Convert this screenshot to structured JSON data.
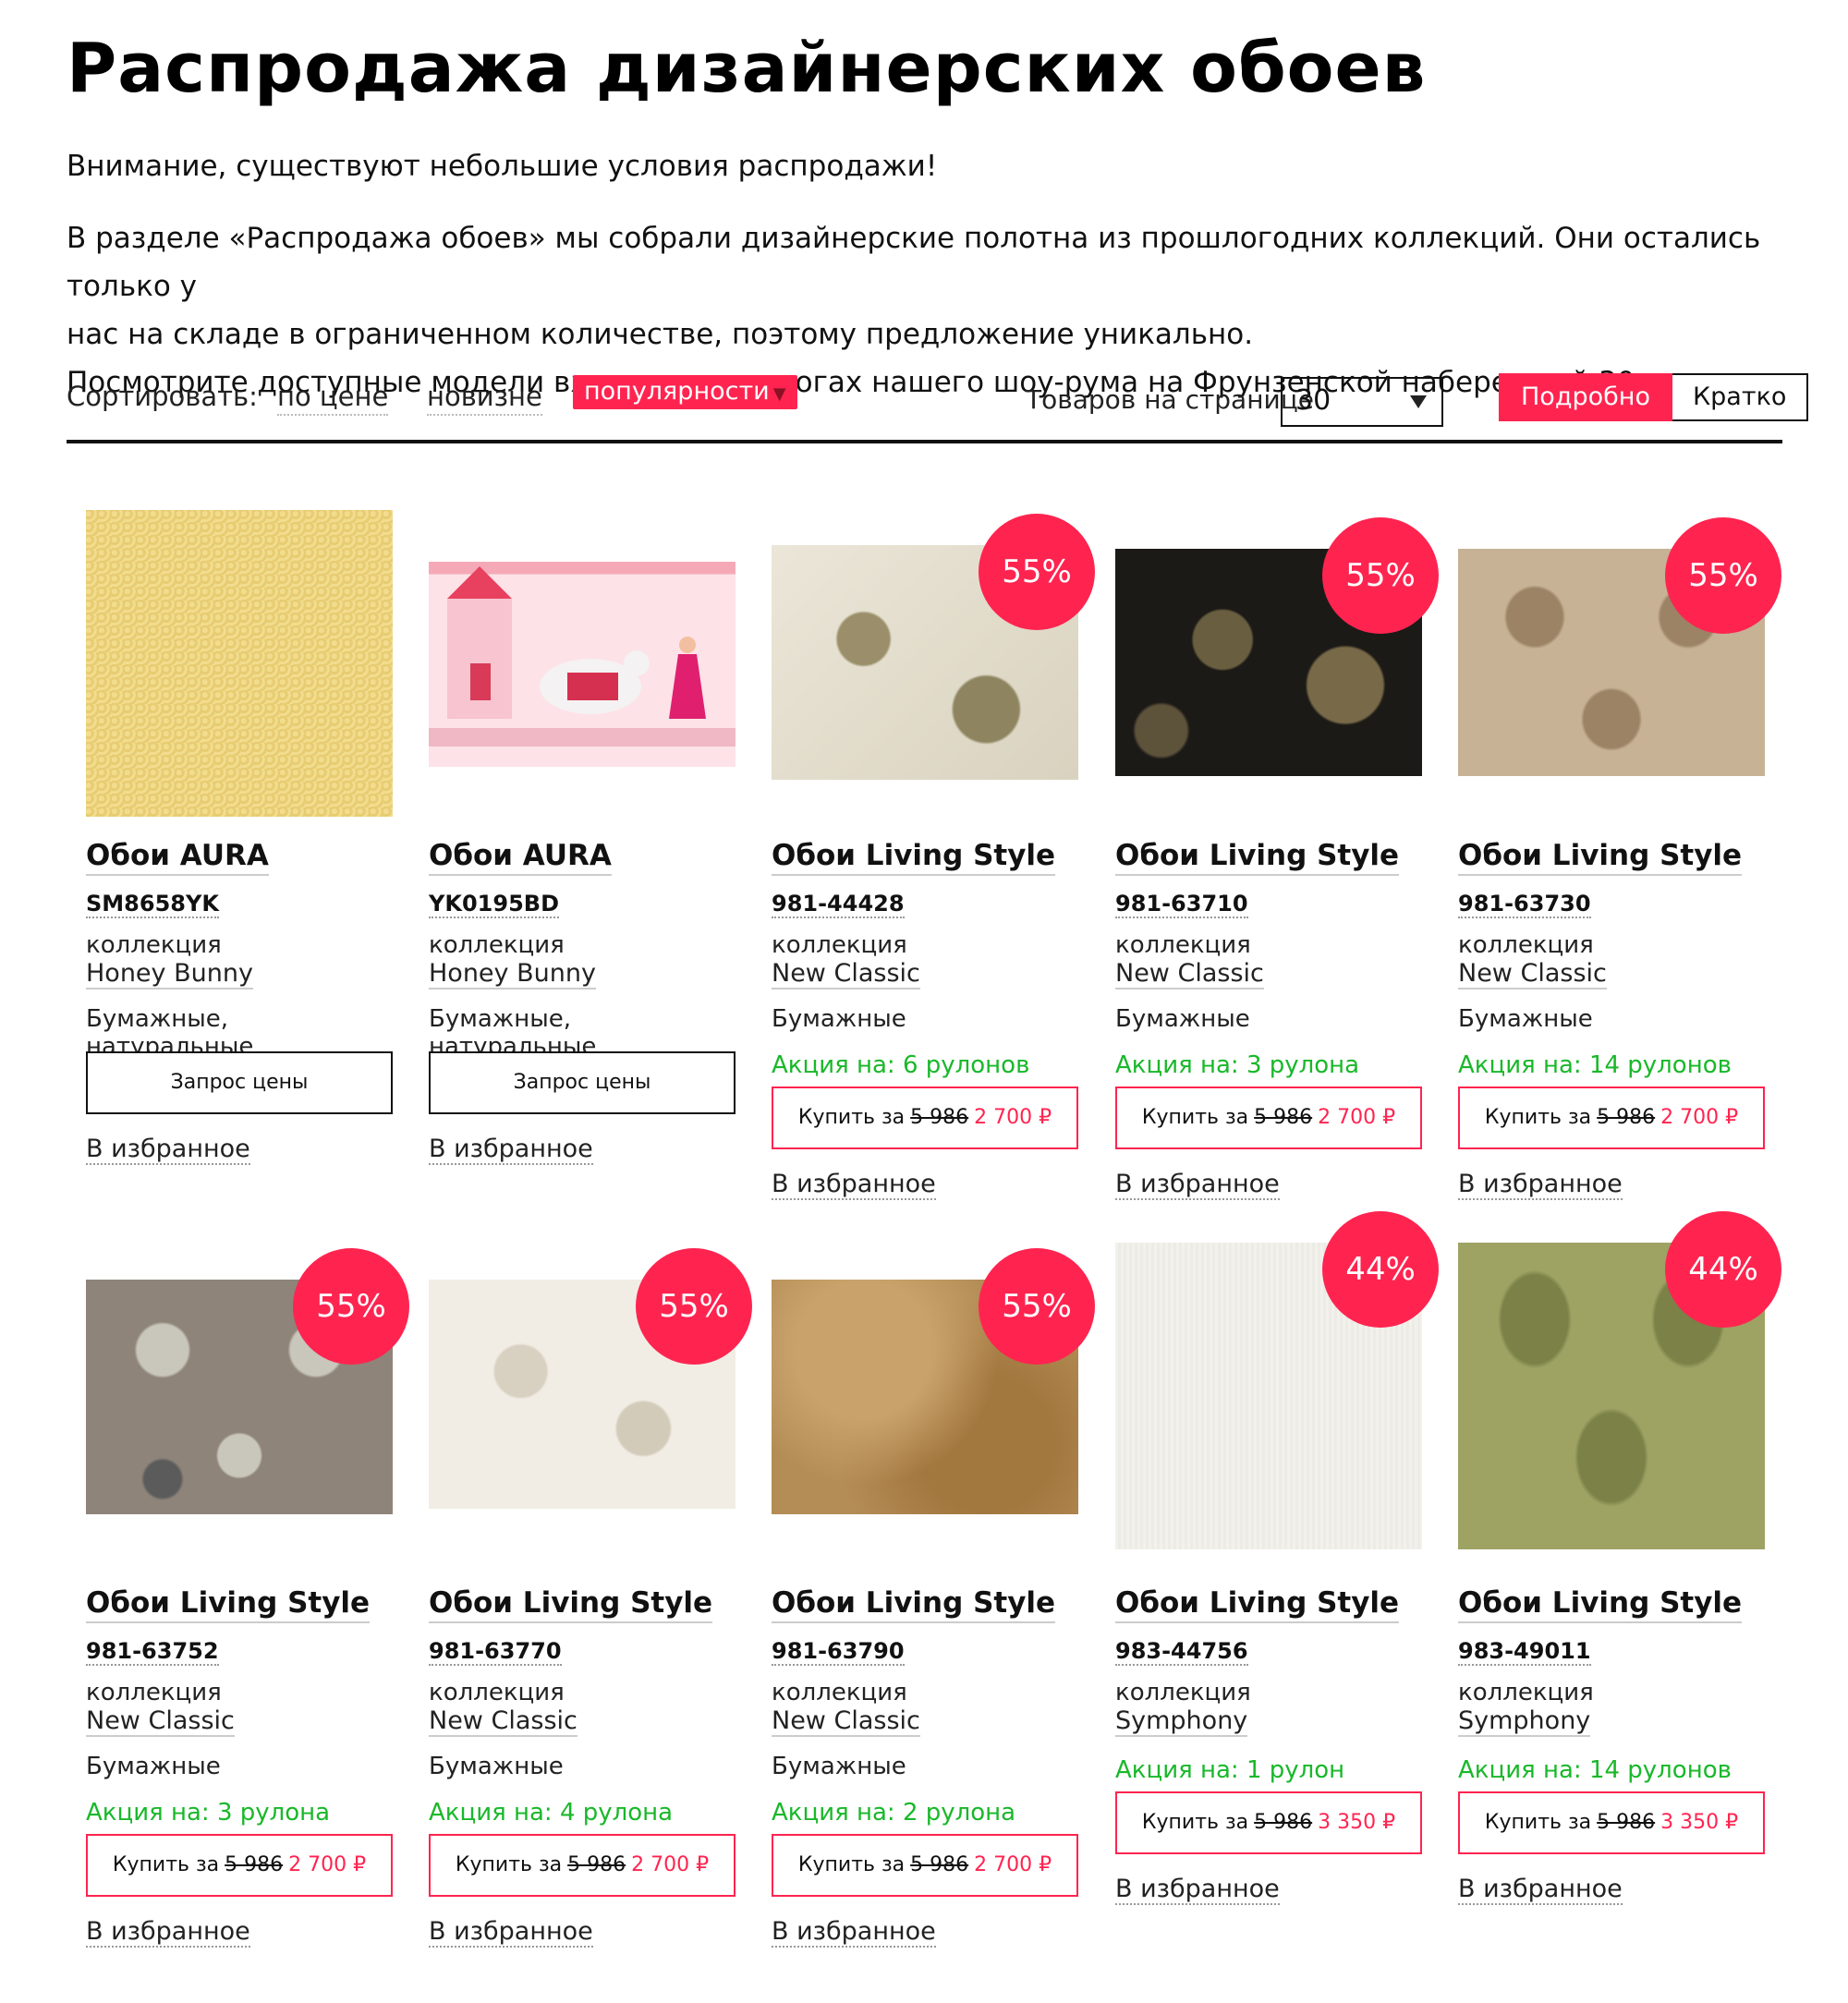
{
  "page": {
    "title": "Распродажа дизайнерских обоев",
    "notice": "Внимание, существуют небольшие условия распродажи!",
    "intro_line1": "В разделе «Распродажа обоев» мы собрали дизайнерские полотна из прошлогодних коллекций. Они остались только у",
    "intro_line2": "нас на складе в ограниченном количестве, поэтому предложение уникально.",
    "intro_line3": "Посмотрите доступные модели вживую в каталогах нашего шоу-рума на Фрунзенской набережной 30."
  },
  "toolbar": {
    "sort_label": "Сортировать:",
    "sort_price": "по цене",
    "sort_new": "новизне",
    "sort_popular": "популярности",
    "per_page_label": "Товаров на странице",
    "per_page_value": "30",
    "view_detailed": "Подробно",
    "view_brief": "Кратко"
  },
  "labels": {
    "collection": "коллекция",
    "favorite": "В избранное",
    "request_price": "Запрос цены",
    "buy_for": "Купить за",
    "currency": "₽"
  },
  "colors": {
    "accent": "#ff2450",
    "promo": "#19b82a"
  },
  "products": [
    {
      "title": "Обои AURA",
      "sku": "SM8658YK",
      "collection": "Honey Bunny",
      "material": "Бумажные, натуральные",
      "badge": "",
      "promo": "",
      "old_price": "",
      "new_price": "",
      "pattern": "gold"
    },
    {
      "title": "Обои AURA",
      "sku": "YK0195BD",
      "collection": "Honey Bunny",
      "material": "Бумажные, натуральные",
      "badge": "",
      "promo": "",
      "old_price": "",
      "new_price": "",
      "pattern": "pink-castle"
    },
    {
      "title": "Обои Living Style",
      "sku": "981-44428",
      "collection": "New Classic",
      "material": "Бумажные",
      "badge": "55%",
      "promo": "Акция на: 6 рулонов",
      "old_price": "5 986",
      "new_price": "2 700 ₽",
      "pattern": "cream-swirl"
    },
    {
      "title": "Обои Living Style",
      "sku": "981-63710",
      "collection": "New Classic",
      "material": "Бумажные",
      "badge": "55%",
      "promo": "Акция на: 3 рулона",
      "old_price": "5 986",
      "new_price": "2 700 ₽",
      "pattern": "black-swirl"
    },
    {
      "title": "Обои Living Style",
      "sku": "981-63730",
      "collection": "New Classic",
      "material": "Бумажные",
      "badge": "55%",
      "promo": "Акция на: 14 рулонов",
      "old_price": "5 986",
      "new_price": "2 700 ₽",
      "pattern": "beige-damask"
    },
    {
      "title": "Обои Living Style",
      "sku": "981-63752",
      "collection": "New Classic",
      "material": "Бумажные",
      "badge": "55%",
      "promo": "Акция на: 3 рулона",
      "old_price": "5 986",
      "new_price": "2 700 ₽",
      "pattern": "grey-floral"
    },
    {
      "title": "Обои Living Style",
      "sku": "981-63770",
      "collection": "New Classic",
      "material": "Бумажные",
      "badge": "55%",
      "promo": "Акция на: 4 рулона",
      "old_price": "5 986",
      "new_price": "2 700 ₽",
      "pattern": "white-floral"
    },
    {
      "title": "Обои Living Style",
      "sku": "981-63790",
      "collection": "New Classic",
      "material": "Бумажные",
      "badge": "55%",
      "promo": "Акция на: 2 рулона",
      "old_price": "5 986",
      "new_price": "2 700 ₽",
      "pattern": "brown"
    },
    {
      "title": "Обои Living Style",
      "sku": "983-44756",
      "collection": "Symphony",
      "material": "",
      "badge": "44%",
      "promo": "Акция на: 1 рулон",
      "old_price": "5 986",
      "new_price": "3 350 ₽",
      "pattern": "white-stripe"
    },
    {
      "title": "Обои Living Style",
      "sku": "983-49011",
      "collection": "Symphony",
      "material": "",
      "badge": "44%",
      "promo": "Акция на: 14 рулонов",
      "old_price": "5 986",
      "new_price": "3 350 ₽",
      "pattern": "olive-damask"
    }
  ]
}
